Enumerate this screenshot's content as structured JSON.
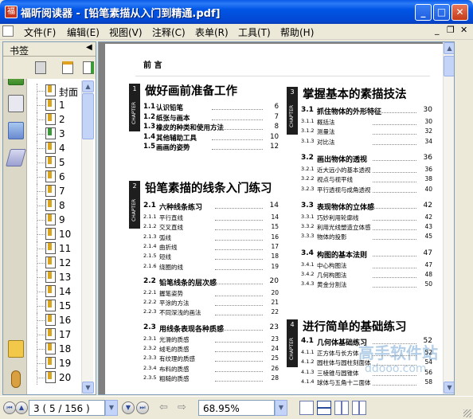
{
  "window": {
    "title": "福昕阅读器 - [铅笔素描从入门到精通.pdf]",
    "min": "_",
    "max": "□",
    "close": "✕"
  },
  "menu": [
    "文件(F)",
    "编辑(E)",
    "视图(V)",
    "注释(C)",
    "表单(R)",
    "工具(T)",
    "帮助(H)"
  ],
  "sidebar": {
    "header": "书签",
    "bookmarks": [
      "封面",
      "1",
      "2",
      "3",
      "4",
      "5",
      "6",
      "7",
      "8",
      "9",
      "10",
      "11",
      "12",
      "13",
      "14",
      "15",
      "16",
      "17",
      "18",
      "19",
      "20"
    ]
  },
  "document": {
    "preface": "前 言",
    "chapters": [
      {
        "num": "1",
        "tab": "CHAPTER",
        "title": "做好画前准备工作",
        "items": [
          {
            "n": "1.1",
            "t": "认识铅笔",
            "p": "6"
          },
          {
            "n": "1.2",
            "t": "纸张与画本",
            "p": "7"
          },
          {
            "n": "1.3",
            "t": "橡皮的种类和使用方法",
            "p": "8"
          },
          {
            "n": "1.4",
            "t": "其他辅助工具",
            "p": "10"
          },
          {
            "n": "1.5",
            "t": "画画的姿势",
            "p": "12"
          }
        ]
      },
      {
        "num": "2",
        "tab": "CHAPTER",
        "title": "铅笔素描的线条入门练习",
        "sections": [
          {
            "n": "2.1",
            "t": "六种线条练习",
            "p": "14",
            "subs": [
              {
                "n": "2.1.1",
                "t": "平行直线",
                "p": "14"
              },
              {
                "n": "2.1.2",
                "t": "交叉直线",
                "p": "15"
              },
              {
                "n": "2.1.3",
                "t": "弧线",
                "p": "16"
              },
              {
                "n": "2.1.4",
                "t": "曲折线",
                "p": "17"
              },
              {
                "n": "2.1.5",
                "t": "短线",
                "p": "18"
              },
              {
                "n": "2.1.6",
                "t": "绕圈的线",
                "p": "19"
              }
            ]
          },
          {
            "n": "2.2",
            "t": "铅笔线条的层次感",
            "p": "20",
            "subs": [
              {
                "n": "2.2.1",
                "t": "握笔姿势",
                "p": "20"
              },
              {
                "n": "2.2.2",
                "t": "平涂的方法",
                "p": "21"
              },
              {
                "n": "2.2.3",
                "t": "不同深浅的画法",
                "p": "22"
              }
            ]
          },
          {
            "n": "2.3",
            "t": "用线条表现各种质感",
            "p": "23",
            "subs": [
              {
                "n": "2.3.1",
                "t": "光滑的质感",
                "p": "23"
              },
              {
                "n": "2.3.2",
                "t": "绒毛的质感",
                "p": "24"
              },
              {
                "n": "2.3.3",
                "t": "有纹理的质感",
                "p": "25"
              },
              {
                "n": "2.3.4",
                "t": "布料的质感",
                "p": "26"
              },
              {
                "n": "2.3.5",
                "t": "粗糙的质感",
                "p": "28"
              }
            ]
          }
        ]
      },
      {
        "num": "3",
        "tab": "CHAPTER",
        "title": "掌握基本的素描技法",
        "sections": [
          {
            "n": "3.1",
            "t": "抓住物体的外形特征",
            "p": "30",
            "subs": [
              {
                "n": "3.1.1",
                "t": "概括法",
                "p": "30"
              },
              {
                "n": "3.1.2",
                "t": "测量法",
                "p": "32"
              },
              {
                "n": "3.1.3",
                "t": "对比法",
                "p": "34"
              }
            ]
          },
          {
            "n": "3.2",
            "t": "画出物体的透视",
            "p": "36",
            "subs": [
              {
                "n": "3.2.1",
                "t": "近大远小的基本透视",
                "p": "36"
              },
              {
                "n": "3.2.2",
                "t": "视点与视平线",
                "p": "38"
              },
              {
                "n": "3.2.3",
                "t": "平行透视与成角透视",
                "p": "40"
              }
            ]
          },
          {
            "n": "3.3",
            "t": "表现物体的立体感",
            "p": "42",
            "subs": [
              {
                "n": "3.3.1",
                "t": "巧妙利用轮廓线",
                "p": "42"
              },
              {
                "n": "3.3.2",
                "t": "利用光线塑造立体感",
                "p": "43"
              },
              {
                "n": "3.3.3",
                "t": "物体的投影",
                "p": "45"
              }
            ]
          },
          {
            "n": "3.4",
            "t": "构图的基本法则",
            "p": "47",
            "subs": [
              {
                "n": "3.4.1",
                "t": "中心构图法",
                "p": "47"
              },
              {
                "n": "3.4.2",
                "t": "几何构图法",
                "p": "48"
              },
              {
                "n": "3.4.3",
                "t": "黄金分割法",
                "p": "50"
              }
            ]
          }
        ]
      },
      {
        "num": "4",
        "tab": "CHAPTER",
        "title": "进行简单的基础练习",
        "sections": [
          {
            "n": "4.1",
            "t": "几何体基础练习",
            "p": "52",
            "subs": [
              {
                "n": "4.1.1",
                "t": "正方体与长方体",
                "p": "52"
              },
              {
                "n": "4.1.2",
                "t": "圆柱体与圆柱刻面体",
                "p": "54"
              },
              {
                "n": "4.1.3",
                "t": "三棱锥与圆锥体",
                "p": "56"
              },
              {
                "n": "4.1.4",
                "t": "球体与五角十二面体",
                "p": "58"
              }
            ]
          }
        ]
      }
    ],
    "watermark": {
      "line1": "高手软件站",
      "line2": "ddooo.com"
    }
  },
  "status": {
    "page_display": "3  ( 5 / 156 )",
    "zoom": "68.95%"
  }
}
